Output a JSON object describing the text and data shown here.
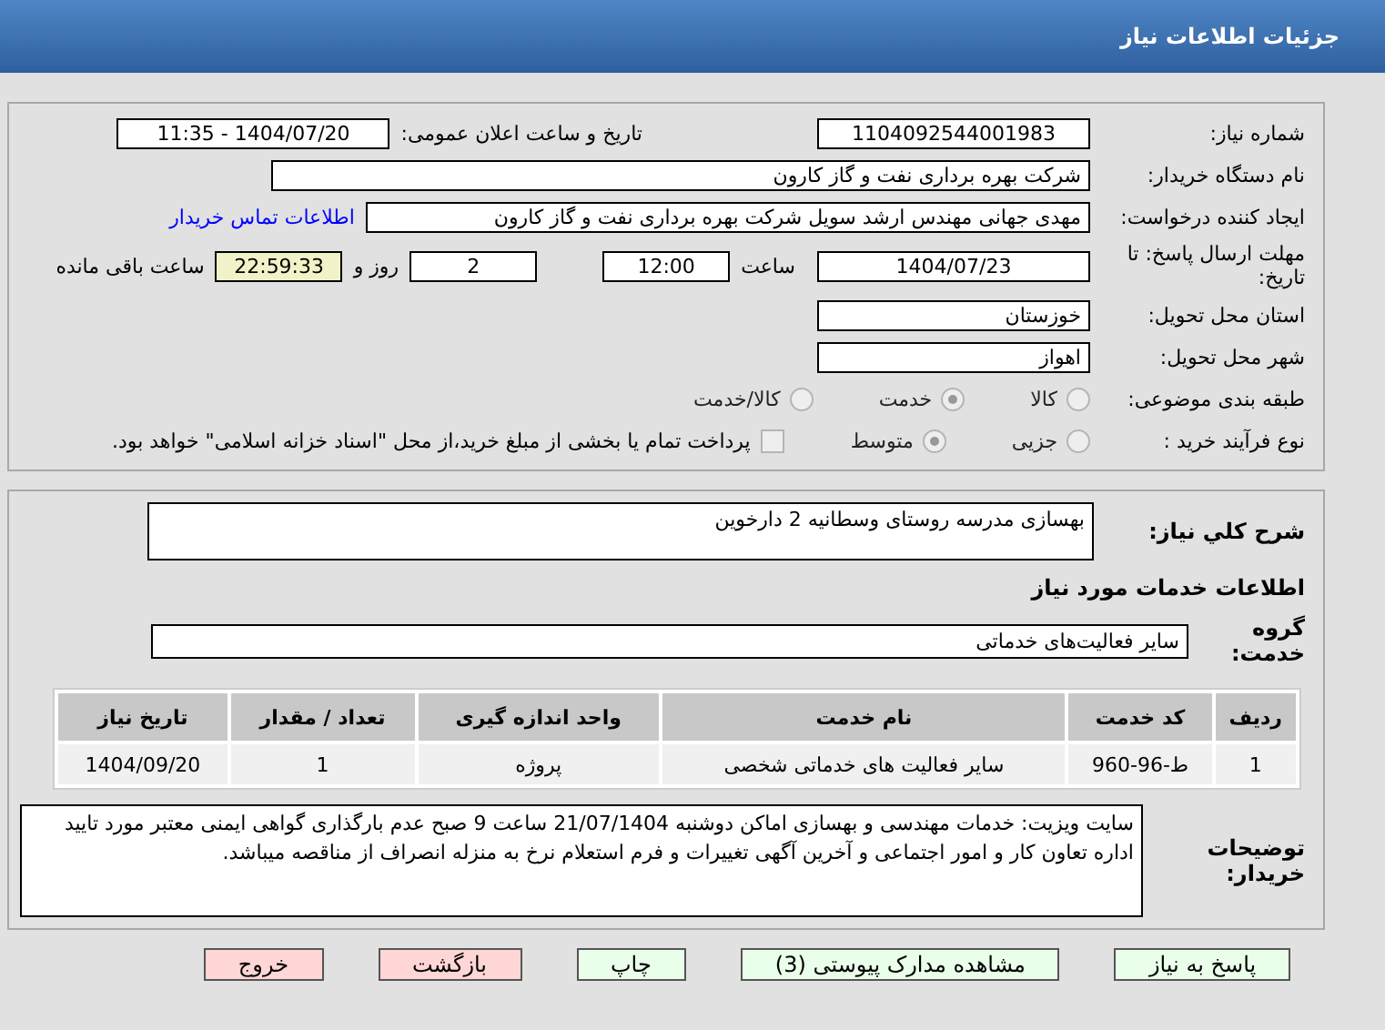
{
  "header": {
    "title": "جزئیات اطلاعات نیاز"
  },
  "need_number": {
    "label": "شماره نیاز:",
    "value": "1104092544001983"
  },
  "announce": {
    "label": "تاریخ و ساعت اعلان عمومی:",
    "value": "1404/07/20 - 11:35"
  },
  "buyer": {
    "label": "نام دستگاه خریدار:",
    "value": "شرکت بهره برداری نفت و گاز کارون"
  },
  "creator": {
    "label": "ایجاد کننده درخواست:",
    "value": "مهدی جهانی مهندس ارشد سویل شرکت بهره برداری نفت و گاز کارون",
    "link": "اطلاعات تماس خریدار"
  },
  "deadline": {
    "label": "مهلت ارسال پاسخ: تا تاریخ:",
    "date": "1404/07/23",
    "time_label": "ساعت",
    "time": "12:00",
    "days": "2",
    "days_label": "روز و",
    "remaining": "22:59:33",
    "remaining_label": "ساعت باقی مانده"
  },
  "province": {
    "label": "استان محل تحویل:",
    "value": "خوزستان"
  },
  "city": {
    "label": "شهر محل تحویل:",
    "value": "اهواز"
  },
  "category": {
    "label": "طبقه بندی موضوعی:",
    "options": [
      {
        "label": "کالا",
        "selected": false
      },
      {
        "label": "خدمت",
        "selected": true
      },
      {
        "label": "کالا/خدمت",
        "selected": false
      }
    ]
  },
  "process": {
    "label": "نوع فرآیند خرید :",
    "options": [
      {
        "label": "جزیی",
        "selected": false
      },
      {
        "label": "متوسط",
        "selected": true
      }
    ],
    "payment": {
      "checked": false,
      "text": "پرداخت تمام یا بخشی از مبلغ خرید،از محل \"اسناد خزانه اسلامی\" خواهد بود."
    }
  },
  "description": {
    "label": "شرح کلي نياز:",
    "value": "بهسازی مدرسه روستای وسطانیه 2 دارخوین"
  },
  "services_title": "اطلاعات خدمات مورد نیاز",
  "service_group": {
    "label": "گروه خدمت:",
    "value": "سایر فعالیت‌های خدماتی"
  },
  "table": {
    "columns": [
      "ردیف",
      "کد خدمت",
      "نام خدمت",
      "واحد اندازه گیری",
      "تعداد / مقدار",
      "تاریخ نیاز"
    ],
    "rows": [
      [
        "1",
        "ط-96-960",
        "سایر فعالیت های خدماتی شخصی",
        "پروژه",
        "1",
        "1404/09/20"
      ]
    ]
  },
  "buyer_notes": {
    "label": "توضیحات خریدار:",
    "value": "سایت ویزیت: خدمات مهندسی و بهسازی اماکن دوشنبه  21/07/1404 ساعت 9 صبح عدم بارگذاری گواهی ایمنی معتبر مورد تایید اداره تعاون کار و امور اجتماعی و آخرین آگهی تغییرات و فرم استعلام نرخ به منزله انصراف از مناقصه میباشد."
  },
  "buttons": [
    {
      "label": "پاسخ به نیاز",
      "kind": "green"
    },
    {
      "label": "مشاهده مدارک پیوستی (3)",
      "kind": "green"
    },
    {
      "label": "چاپ",
      "kind": "green"
    },
    {
      "label": "بازگشت",
      "kind": "red"
    },
    {
      "label": "خروج",
      "kind": "red"
    }
  ]
}
